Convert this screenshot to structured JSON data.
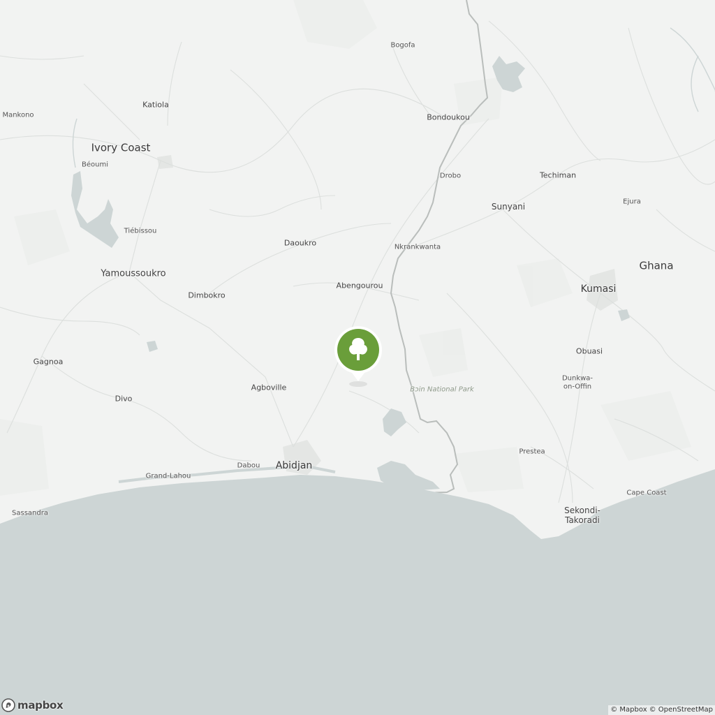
{
  "map": {
    "colors": {
      "land": "#f2f3f2",
      "water": "#cdd5d5",
      "border": "#b9bdbb",
      "road": "#dcdfdd",
      "urban": "#e6e8e6",
      "marker": "#6a9e3a"
    },
    "labels": {
      "country_ivory_coast": "Ivory Coast",
      "country_ghana": "Ghana",
      "abidjan": "Abidjan",
      "kumasi": "Kumasi",
      "yamoussoukro": "Yamoussoukro",
      "sunyani": "Sunyani",
      "sekondi_takoradi": "Sekondi-\nTakoradi",
      "bogofa": "Bogofa",
      "katiola": "Katiola",
      "mankono": "Mankono",
      "beoumi": "Béoumi",
      "tiebissou": "Tiébissou",
      "bondoukou": "Bondoukou",
      "drobo": "Drobo",
      "techiman": "Techiman",
      "ejura": "Ejura",
      "daoukro": "Daoukro",
      "nkrankwanta": "Nkrankwanta",
      "abengourou": "Abengourou",
      "dimbokro": "Dimbokro",
      "gagnoa": "Gagnoa",
      "divo": "Divo",
      "agboville": "Agboville",
      "obuasi": "Obuasi",
      "dunkwa": "Dunkwa-\non-Offin",
      "bia_park": "Bɔin National Park",
      "prestea": "Prestea",
      "dabou": "Dabou",
      "grand_lahou": "Grand-Lahou",
      "sassandra": "Sassandra",
      "cape_coast": "Cape Coast"
    },
    "marker_icon": "tree-icon"
  },
  "logo": {
    "text": "mapbox",
    "icon": "mapbox-logo-icon"
  },
  "attribution": {
    "mapbox": "© Mapbox",
    "osm": "© OpenStreetMap"
  }
}
